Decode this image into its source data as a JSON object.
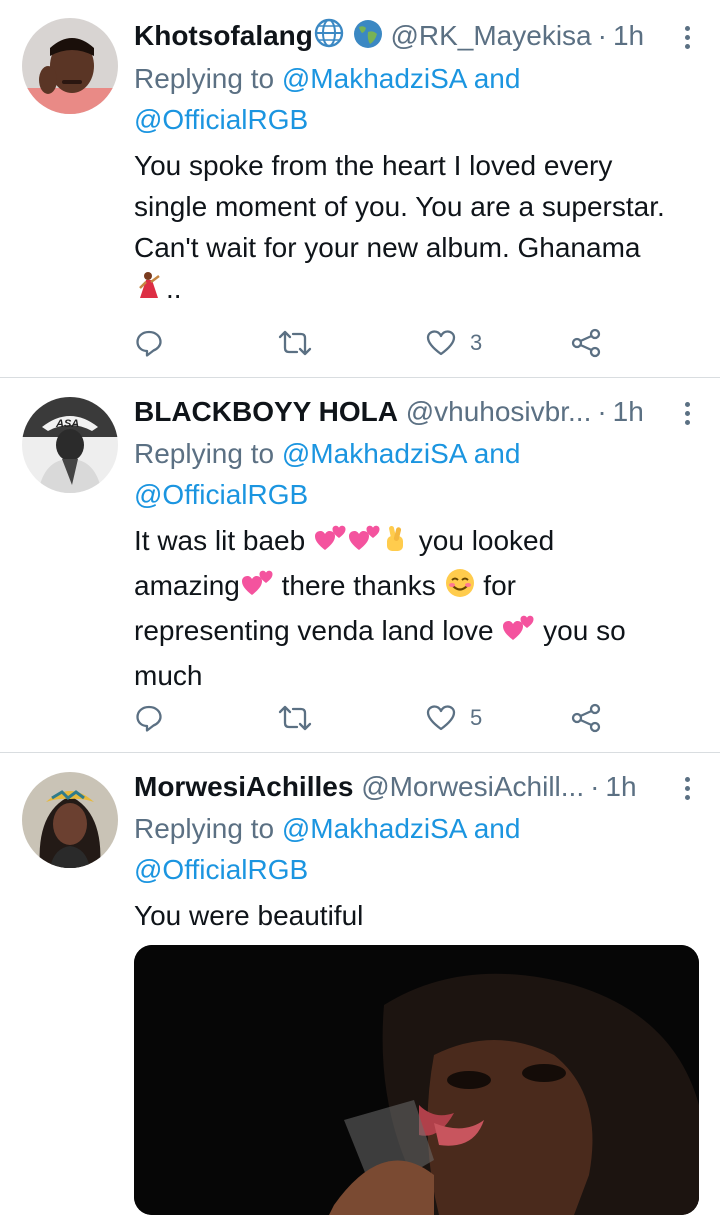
{
  "colors": {
    "link": "#1b95e0",
    "muted": "#5b7083",
    "text": "#0f1419",
    "divider": "#d9dde0"
  },
  "tweets": [
    {
      "name": "Khotsofalang",
      "handle": "@RK_Mayekisa",
      "dot": "·",
      "time": "1h",
      "reply_prefix": "Replying to",
      "mention1": "@MakhadziSA",
      "and": "and",
      "mention2": "@OfficialRGB",
      "line1": "You spoke from the heart I loved every",
      "line2": "single moment of you. You are a superstar.",
      "line3": "Can't wait for your new album. Ghanama",
      "line4": "..",
      "likes": "3",
      "icons": [
        "globe-icon",
        "earth-icon",
        "dancer-emoji"
      ]
    },
    {
      "name": "BLACKBOYY HOLA",
      "handle": "@vhuhosivbr...",
      "dot": "·",
      "time": "1h",
      "reply_prefix": "Replying to",
      "mention1": "@MakhadziSA",
      "and": "and",
      "mention2": "@OfficialRGB",
      "line1a": "It was lit baeb",
      "line1b": "you looked",
      "line2a": "amazing",
      "line2b": "there thanks",
      "line2c": "for",
      "line3a": "representing venda land love",
      "line3b": "you so",
      "line4": "much",
      "likes": "5",
      "icons": [
        "two-hearts-emoji",
        "crossed-fingers-emoji",
        "smiling-face-emoji"
      ]
    },
    {
      "name": "MorwesiAchilles",
      "handle": "@MorwesiAchill...",
      "dot": "·",
      "time": "1h",
      "reply_prefix": "Replying to",
      "mention1": "@MakhadziSA",
      "and": "and",
      "mention2": "@OfficialRGB",
      "line1": "You were beautiful",
      "media": "photo-woman-drinking"
    }
  ]
}
